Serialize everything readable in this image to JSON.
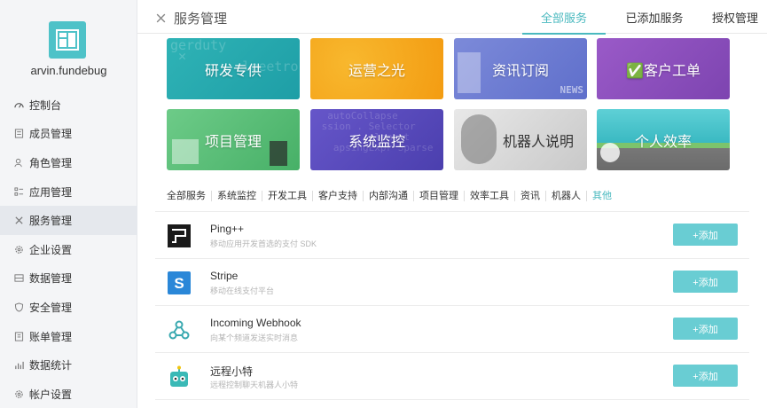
{
  "sidebar": {
    "username": "arvin.fundebug",
    "items": [
      {
        "label": "控制台",
        "icon": "dashboard-icon"
      },
      {
        "label": "成员管理",
        "icon": "member-icon"
      },
      {
        "label": "角色管理",
        "icon": "role-icon"
      },
      {
        "label": "应用管理",
        "icon": "apps-icon"
      },
      {
        "label": "服务管理",
        "icon": "tools-icon"
      },
      {
        "label": "企业设置",
        "icon": "gear-icon"
      },
      {
        "label": "数据管理",
        "icon": "data-icon"
      },
      {
        "label": "安全管理",
        "icon": "shield-icon"
      },
      {
        "label": "账单管理",
        "icon": "bill-icon"
      },
      {
        "label": "数据统计",
        "icon": "stats-icon"
      },
      {
        "label": "帐户设置",
        "icon": "gear-icon"
      }
    ]
  },
  "header": {
    "title": "服务管理",
    "tabs": [
      "全部服务",
      "已添加服务",
      "授权管理"
    ]
  },
  "cards": [
    {
      "label": "研发专供",
      "color": "#2fb1b3"
    },
    {
      "label": "运营之光",
      "color": "#f5a623"
    },
    {
      "label": "资讯订阅",
      "color": "#6f7fd6"
    },
    {
      "label": "✅客户工单",
      "color": "#8e4fbf"
    },
    {
      "label": "项目管理",
      "color": "#5fc27a"
    },
    {
      "label": "系统监控",
      "color": "#5a4fbf"
    },
    {
      "label": "机器人说明",
      "color": "#d8d8d8"
    },
    {
      "label": "个人效率",
      "color": "#36b9c2"
    }
  ],
  "categories": [
    "全部服务",
    "系统监控",
    "开发工具",
    "客户支持",
    "内部沟通",
    "项目管理",
    "效率工具",
    "资讯",
    "机器人",
    "其他"
  ],
  "services": [
    {
      "name": "Ping++",
      "desc": "移动应用开发首选的支付 SDK",
      "icon": "pingpp-icon",
      "button": "+添加"
    },
    {
      "name": "Stripe",
      "desc": "移动在线支付平台",
      "icon": "stripe-icon",
      "button": "+添加"
    },
    {
      "name": "Incoming Webhook",
      "desc": "向某个频道发送实时消息",
      "icon": "webhook-icon",
      "button": "+添加"
    },
    {
      "name": "远程小特",
      "desc": "远程控制聊天机器人小特",
      "icon": "robot-icon",
      "button": "+添加"
    }
  ],
  "colors": {
    "accent": "#4ab9bf",
    "button": "#69cdd3"
  }
}
